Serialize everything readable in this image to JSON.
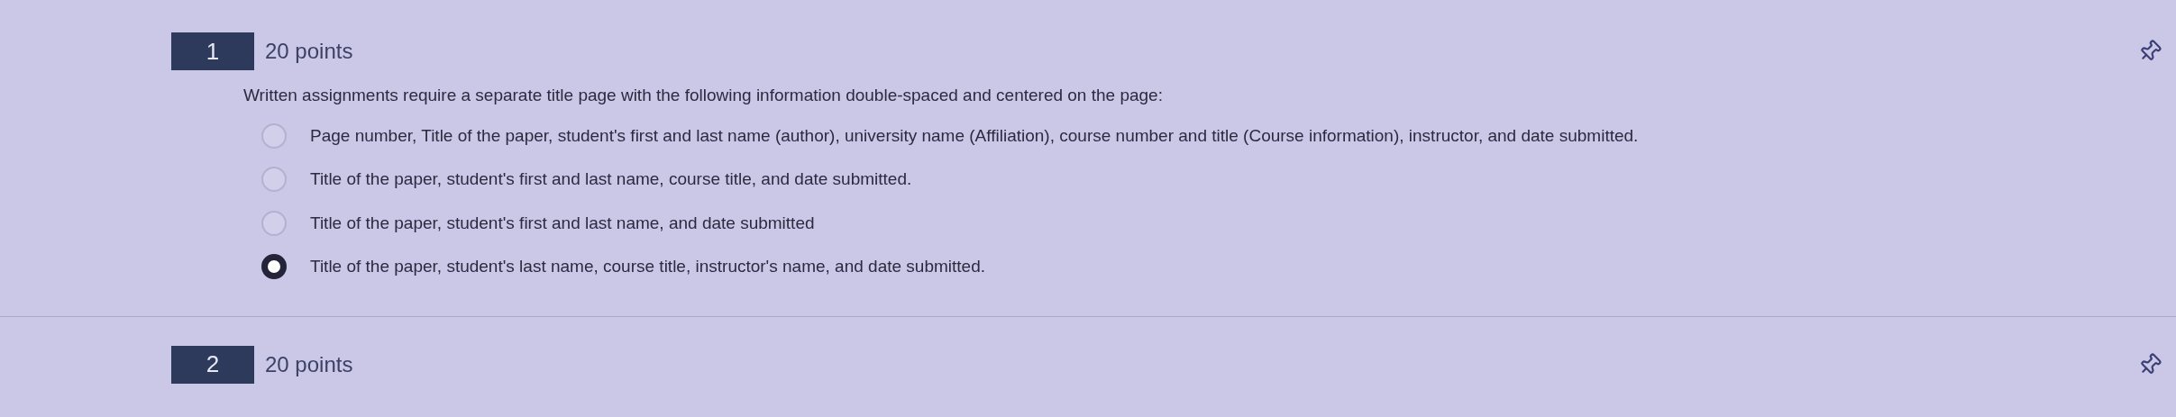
{
  "questions": [
    {
      "number": "1",
      "points": "20 points",
      "prompt": "Written assignments require a separate title page with the following information double-spaced and centered on the page:",
      "options": [
        {
          "label": "Page number, Title of the paper, student's first and last name (author), university name (Affiliation), course number and title (Course information), instructor, and date submitted.",
          "selected": false
        },
        {
          "label": "Title of the paper, student's first and last name, course title, and date submitted.",
          "selected": false
        },
        {
          "label": "Title of the paper, student's first and last name, and date submitted",
          "selected": false
        },
        {
          "label": "Title of the paper, student's last name, course title, instructor's name, and date submitted.",
          "selected": true
        }
      ]
    },
    {
      "number": "2",
      "points": "20 points"
    }
  ]
}
